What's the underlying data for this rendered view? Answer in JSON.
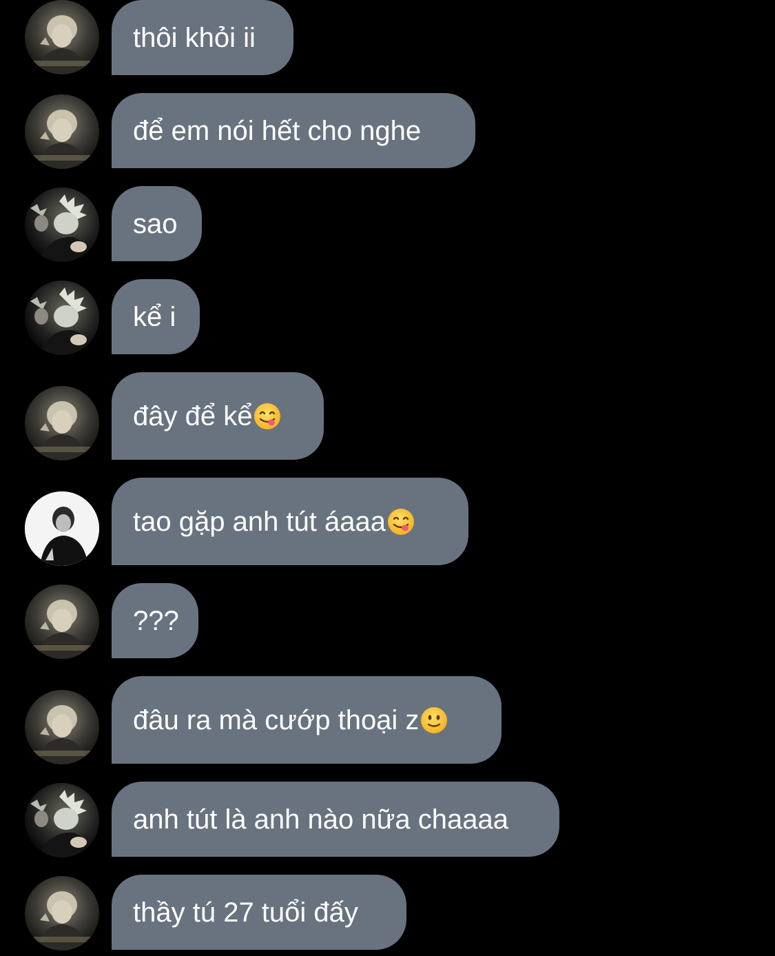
{
  "conversation": {
    "messages": [
      {
        "text": "thôi khỏi ii",
        "avatar": "avatar-photo-a"
      },
      {
        "text": "để em nói hết cho nghe",
        "avatar": "avatar-photo-a"
      },
      {
        "text": "sao",
        "avatar": "avatar-photo-b"
      },
      {
        "text": "kể i",
        "avatar": "avatar-photo-b"
      },
      {
        "text": "đây để kể",
        "emoji": "face-savoring-food-emoji",
        "avatar": "avatar-photo-a"
      },
      {
        "text": "tao gặp anh tút áaaa",
        "emoji": "face-savoring-food-emoji",
        "avatar": "avatar-photo-c"
      },
      {
        "text": "???",
        "avatar": "avatar-photo-a"
      },
      {
        "text": "đâu ra mà cướp thoại z",
        "emoji": "slightly-smiling-face-emoji",
        "avatar": "avatar-photo-a"
      },
      {
        "text": "anh tút là anh nào nữa chaaaa",
        "avatar": "avatar-photo-b"
      },
      {
        "text": "thầy tú 27 tuổi đấy",
        "avatar": "avatar-photo-a"
      }
    ]
  },
  "colors": {
    "background": "#000000",
    "bubble": "#69737f",
    "text": "#ffffff"
  }
}
